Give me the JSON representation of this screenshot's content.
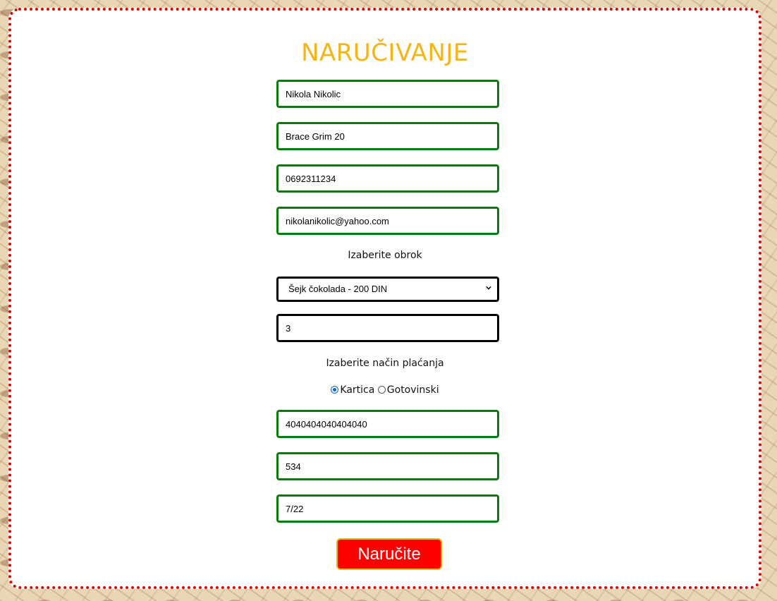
{
  "form": {
    "title": "NARUČIVANJE",
    "name_value": "Nikola Nikolic",
    "address_value": "Brace Grim 20",
    "phone_value": "0692311234",
    "email_value": "nikolanikolic@yahoo.com",
    "meal_label": "Izaberite obrok",
    "meal_selected": "Šejk čokolada - 200 DIN",
    "quantity_value": "3",
    "payment_label": "Izaberite način plaćanja",
    "payment_options": [
      {
        "label": "Kartica",
        "checked": true
      },
      {
        "label": "Gotovinski",
        "checked": false
      }
    ],
    "card_number_value": "4040404040404040",
    "cvv_value": "534",
    "expiry_value": "7/22",
    "submit_label": "Naručite"
  },
  "colors": {
    "title": "#f7b514",
    "input_border": "#0c7a0c",
    "card_border": "#e00000",
    "submit_bg": "#ff0000",
    "submit_border": "#f2b400",
    "radio_checked": "#0b66d1",
    "page_bg": "#e8d6b4"
  },
  "icons": {
    "select_arrow": "chevron-down-icon"
  }
}
